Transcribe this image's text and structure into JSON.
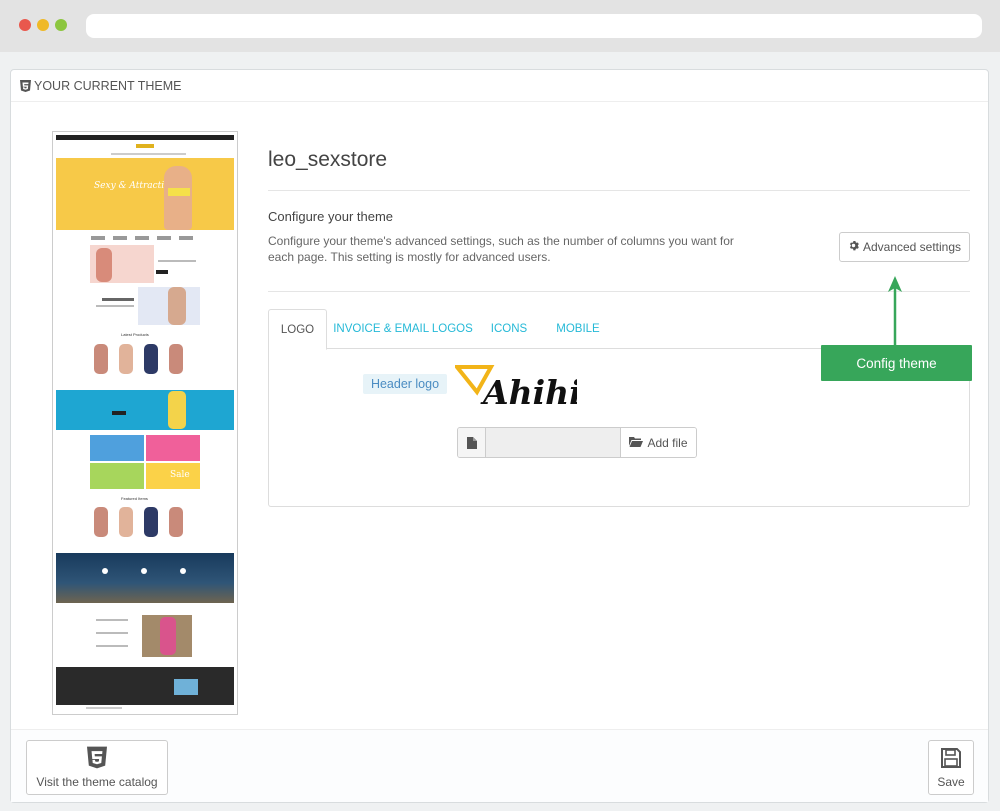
{
  "panel": {
    "heading": "YOUR CURRENT THEME",
    "heading_icon": "html5-icon"
  },
  "theme": {
    "name": "leo_sexstore",
    "configure_title": "Configure your theme",
    "configure_desc": "Configure your theme's advanced settings, such as the number of columns you want for each page. This setting is mostly for advanced users.",
    "advanced_button": "Advanced settings"
  },
  "tabs": [
    {
      "label": "LOGO",
      "active": true
    },
    {
      "label": "INVOICE & EMAIL LOGOS",
      "active": false
    },
    {
      "label": "ICONS",
      "active": false
    },
    {
      "label": "MOBILE",
      "active": false
    }
  ],
  "logo_tab": {
    "header_logo_label": "Header logo",
    "logo_text": "Ahihi",
    "add_file_button": "Add file"
  },
  "annotation": {
    "callout": "Config theme"
  },
  "preview": {
    "banner_text": "Sexy & Attractive",
    "section_latest": "Latest Products",
    "section_featured": "Featured Items",
    "sale_text": "Sale"
  },
  "footer": {
    "catalog_button": "Visit the theme catalog",
    "save_button": "Save"
  },
  "colors": {
    "accent": "#25b9d7",
    "callout_bg": "#37a65a",
    "logo_yellow": "#f2b418"
  }
}
